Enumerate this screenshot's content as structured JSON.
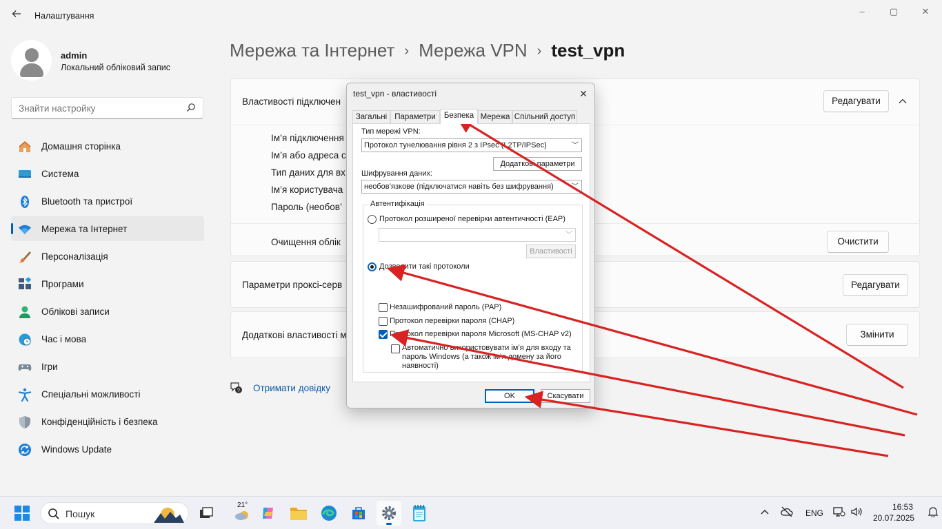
{
  "window": {
    "app_title": "Налаштування",
    "minimize": "–",
    "maximize": "▢",
    "close": "✕"
  },
  "profile": {
    "name": "admin",
    "account_type": "Локальний обліковий запис"
  },
  "search": {
    "placeholder": "Знайти настройку"
  },
  "nav": [
    {
      "label": "Домашня сторінка",
      "icon": "home-icon"
    },
    {
      "label": "Система",
      "icon": "monitor-icon"
    },
    {
      "label": "Bluetooth та пристрої",
      "icon": "bluetooth-icon"
    },
    {
      "label": "Мережа та Інтернет",
      "icon": "wifi-icon",
      "active": true
    },
    {
      "label": "Персоналізація",
      "icon": "brush-icon"
    },
    {
      "label": "Програми",
      "icon": "apps-icon"
    },
    {
      "label": "Облікові записи",
      "icon": "person-icon"
    },
    {
      "label": "Час і мова",
      "icon": "clock-globe-icon"
    },
    {
      "label": "Ігри",
      "icon": "gamepad-icon"
    },
    {
      "label": "Спеціальні можливості",
      "icon": "accessibility-icon"
    },
    {
      "label": "Конфіденційність і безпека",
      "icon": "shield-icon"
    },
    {
      "label": "Windows Update",
      "icon": "update-icon"
    }
  ],
  "breadcrumb": {
    "level1": "Мережа та Інтернет",
    "level2": "Мережа VPN",
    "current": "test_vpn",
    "separator": "›"
  },
  "main": {
    "connection_props": {
      "title": "Властивості підключен",
      "edit_button": "Редагувати",
      "fields": [
        "Ім’я підключення",
        "Ім’я або адреса с",
        "Тип даних для вх",
        "Ім’я користувача",
        "Пароль (необов’"
      ]
    },
    "clear_row": {
      "label": "Очищення облік",
      "button": "Очистити"
    },
    "proxy": {
      "label": "Параметри проксі-серв",
      "button": "Редагувати"
    },
    "advanced": {
      "label": "Додаткові властивості м",
      "button": "Змінити"
    },
    "help_link": "Отримати довідку"
  },
  "dialog": {
    "title": "test_vpn - властивості",
    "tabs": [
      "Загальні",
      "Параметри",
      "Безпека",
      "Мережа",
      "Спільний доступ"
    ],
    "active_tab": "Безпека",
    "vpn_type_label": "Тип мережі VPN:",
    "vpn_type_value": "Протокол тунелювання рівня 2 з IPsec (L2TP/IPSec)",
    "advanced_params_button": "Додаткові параметри",
    "encryption_label": "Шифрування даних:",
    "encryption_value": "необов’язкове (підключатися навіть без шифрування)",
    "auth_group": "Автентифікація",
    "eap_radio": "Протокол розширеної перевірки автентичності (EAP)",
    "eap_select": "",
    "properties_button": "Властивості",
    "allow_radio": "Дозволити такі протоколи",
    "pap": "Незашифрований пароль (PAP)",
    "chap": "Протокол перевірки пароля (CHAP)",
    "mschap": "Протокол перевірки пароля Microsoft (MS-CHAP v2)",
    "auto_logon_line1": "Автоматично використовувати ім’я для входу та",
    "auto_logon_line2": "пароль Windows (а також ім’я домену за його",
    "auto_logon_line3": "наявності)",
    "ok": "OK",
    "cancel": "Скасувати",
    "state": {
      "eap_selected": false,
      "allow_selected": true,
      "pap": false,
      "chap": false,
      "mschap": true,
      "auto_logon": false
    }
  },
  "taskbar": {
    "search_label": "Пошук",
    "weather_temp": "21°",
    "language": "ENG",
    "time": "16:53",
    "date": "20.07.2025"
  },
  "colors": {
    "accent": "#005fb8",
    "annotation_arrow": "#d92323"
  }
}
